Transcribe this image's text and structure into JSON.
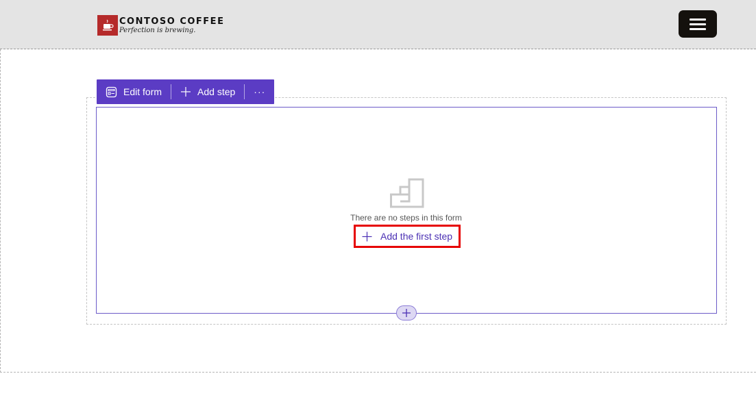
{
  "header": {
    "brand_name": "CONTOSO COFFEE",
    "brand_tagline": "Perfection is brewing.",
    "menu_icon": "hamburger-menu-icon"
  },
  "toolbar": {
    "edit_form_label": "Edit form",
    "add_step_label": "Add step",
    "more_label": "···",
    "edit_icon": "form-edit-icon",
    "add_icon": "plus-icon"
  },
  "form": {
    "empty_icon": "steps-icon",
    "empty_message": "There are no steps in this form",
    "add_first_step_label": "Add the first step"
  },
  "colors": {
    "header_bg": "#e4e4e4",
    "toolbar_bg": "#5b3cc4",
    "brand_red": "#b52a2a",
    "link_purple": "#4b30b4",
    "highlight_red": "#e60000"
  }
}
